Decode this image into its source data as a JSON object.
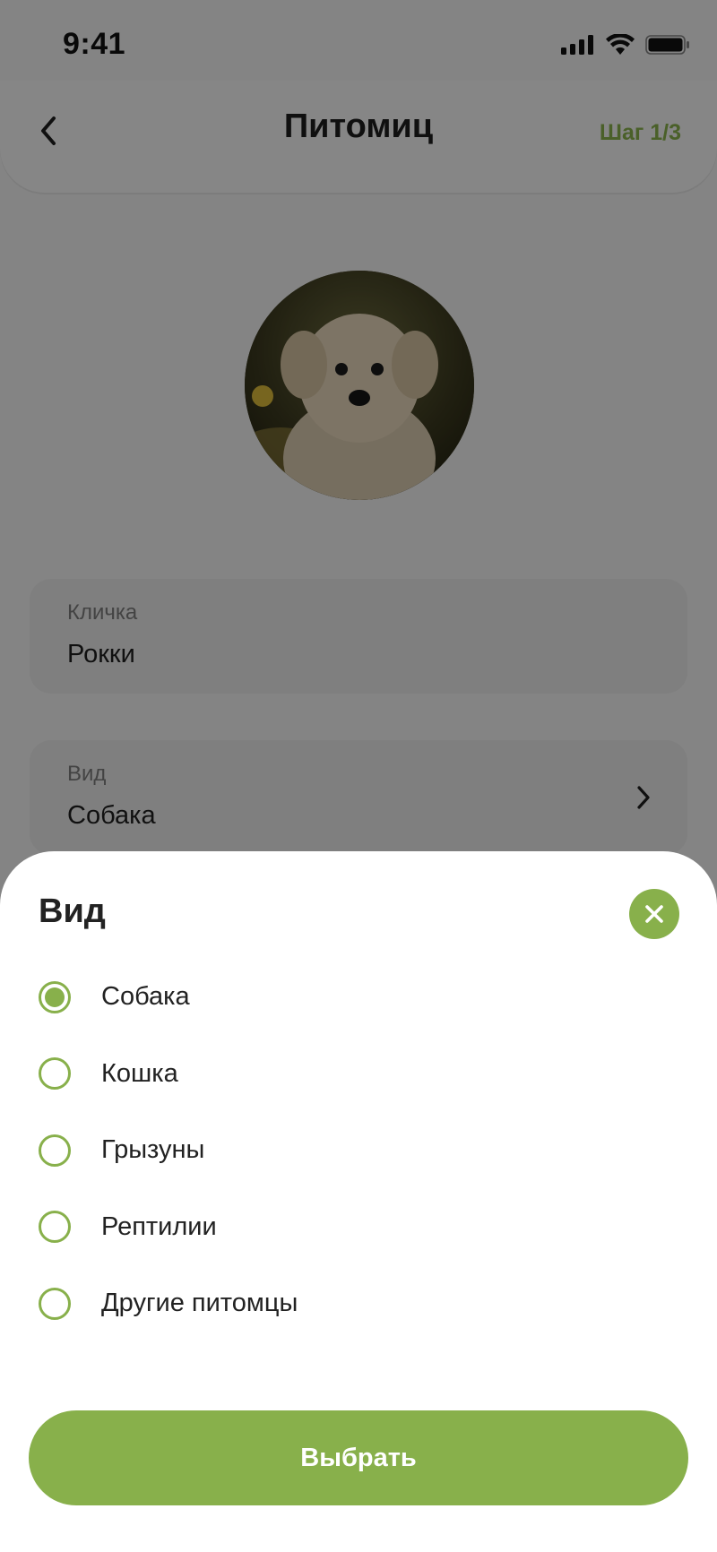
{
  "status_bar": {
    "time": "9:41",
    "icons": [
      "cellular-signal-icon",
      "wifi-icon",
      "battery-icon"
    ]
  },
  "header": {
    "back_icon": "chevron-left-icon",
    "title": "Питомиц",
    "step": "Шаг 1/3"
  },
  "avatar": {
    "description_icon": "pet-photo-avatar"
  },
  "form": {
    "name_field": {
      "label": "Кличка",
      "value": "Рокки"
    },
    "type_field": {
      "label": "Вид",
      "value": "Собака",
      "chevron_icon": "chevron-right-icon"
    }
  },
  "sheet": {
    "title": "Вид",
    "close_icon": "close-icon",
    "options": [
      {
        "label": "Собака",
        "selected": true
      },
      {
        "label": "Кошка",
        "selected": false
      },
      {
        "label": "Грызуны",
        "selected": false
      },
      {
        "label": "Рептилии",
        "selected": false
      },
      {
        "label": "Другие питомцы",
        "selected": false
      }
    ],
    "confirm_label": "Выбрать"
  },
  "colors": {
    "accent": "#88b04b",
    "overlay": "rgba(0,0,0,0.45)",
    "sheet_background": "#ffffff"
  }
}
